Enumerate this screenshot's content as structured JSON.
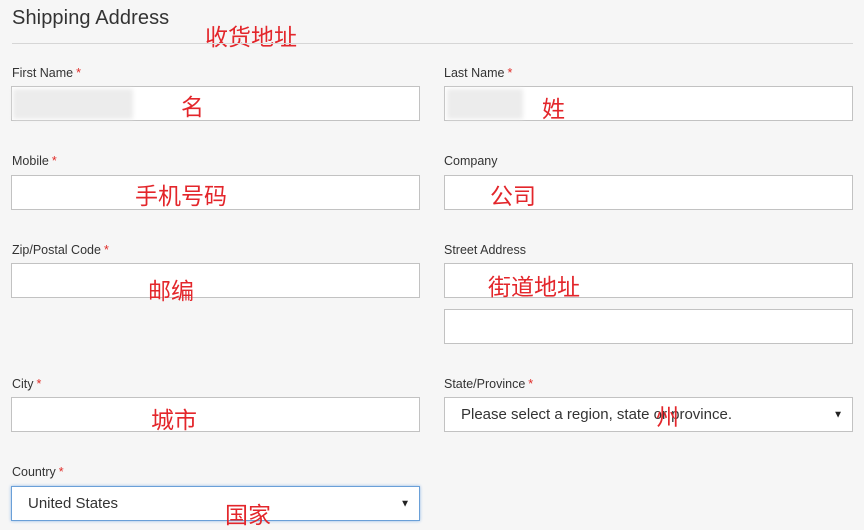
{
  "section": {
    "title": "Shipping Address",
    "required_mark": "*"
  },
  "fields": {
    "first_name": {
      "label": "First Name",
      "value": ""
    },
    "last_name": {
      "label": "Last Name",
      "value": ""
    },
    "mobile": {
      "label": "Mobile",
      "value": ""
    },
    "company": {
      "label": "Company",
      "value": ""
    },
    "zip": {
      "label": "Zip/Postal Code",
      "value": ""
    },
    "street": {
      "label": "Street Address",
      "line1": "",
      "line2": ""
    },
    "city": {
      "label": "City",
      "value": ""
    },
    "state": {
      "label": "State/Province",
      "selected": "Please select a region, state or province."
    },
    "country": {
      "label": "Country",
      "selected": "United States"
    }
  },
  "annotations": {
    "title": "收货地址",
    "first_name": "名",
    "last_name": "姓",
    "mobile": "手机号码",
    "company": "公司",
    "zip": "邮编",
    "street": "街道地址",
    "city": "城市",
    "state": "州",
    "country": "国家"
  },
  "colors": {
    "annotation": "#e3262b",
    "required": "#e02b27",
    "focus_border": "#6aa0d8"
  },
  "icons": {
    "select_caret": "triangle-down"
  }
}
